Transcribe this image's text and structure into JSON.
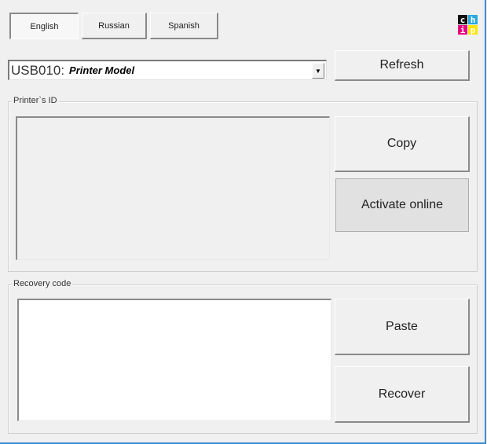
{
  "languages": [
    {
      "label": "English",
      "active": true
    },
    {
      "label": "Russian",
      "active": false
    },
    {
      "label": "Spanish",
      "active": false
    }
  ],
  "logo": {
    "letters": [
      "c",
      "h",
      "i",
      "p"
    ],
    "colors": {
      "c": "#111111",
      "h": "#29a9e1",
      "i": "#e6007e",
      "p": "#ffe600"
    }
  },
  "printer_select": {
    "port": "USB010:",
    "model": "Printer Model"
  },
  "buttons": {
    "refresh": "Refresh",
    "copy": "Copy",
    "activate_online": "Activate online",
    "paste": "Paste",
    "recover": "Recover"
  },
  "printer_id_group": {
    "label": "Printer`s ID",
    "value": ""
  },
  "recovery_group": {
    "label": "Recovery code",
    "value": ""
  }
}
